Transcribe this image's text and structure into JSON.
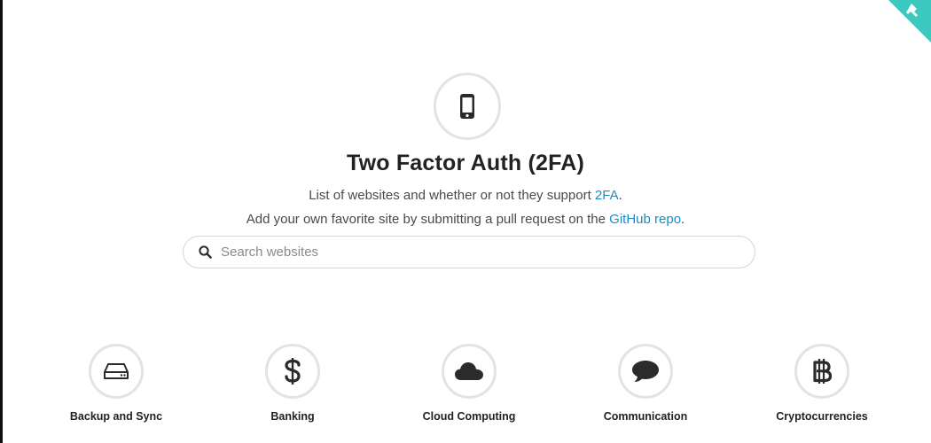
{
  "header": {
    "title": "Two Factor Auth (2FA)",
    "tagline_1_text": "List of websites and whether or not they support ",
    "tagline_1_link": "2FA",
    "tagline_1_end": ".",
    "tagline_2_text": "Add your own favorite site by submitting a pull request on the ",
    "tagline_2_link": "GitHub repo",
    "tagline_2_end": ".",
    "hero_icon": "mobile-phone-icon"
  },
  "search": {
    "placeholder": "Search websites",
    "value": "",
    "icon": "search-icon"
  },
  "categories": [
    {
      "label": "Backup and Sync",
      "icon": "hard-drive-icon"
    },
    {
      "label": "Banking",
      "icon": "dollar-icon"
    },
    {
      "label": "Cloud Computing",
      "icon": "cloud-icon"
    },
    {
      "label": "Communication",
      "icon": "speech-bubble-icon"
    },
    {
      "label": "Cryptocurrencies",
      "icon": "bitcoin-icon"
    }
  ],
  "colors": {
    "link": "#1b8cc4",
    "ring": "#e3e3e3",
    "ribbon": "#3cc9c0"
  }
}
